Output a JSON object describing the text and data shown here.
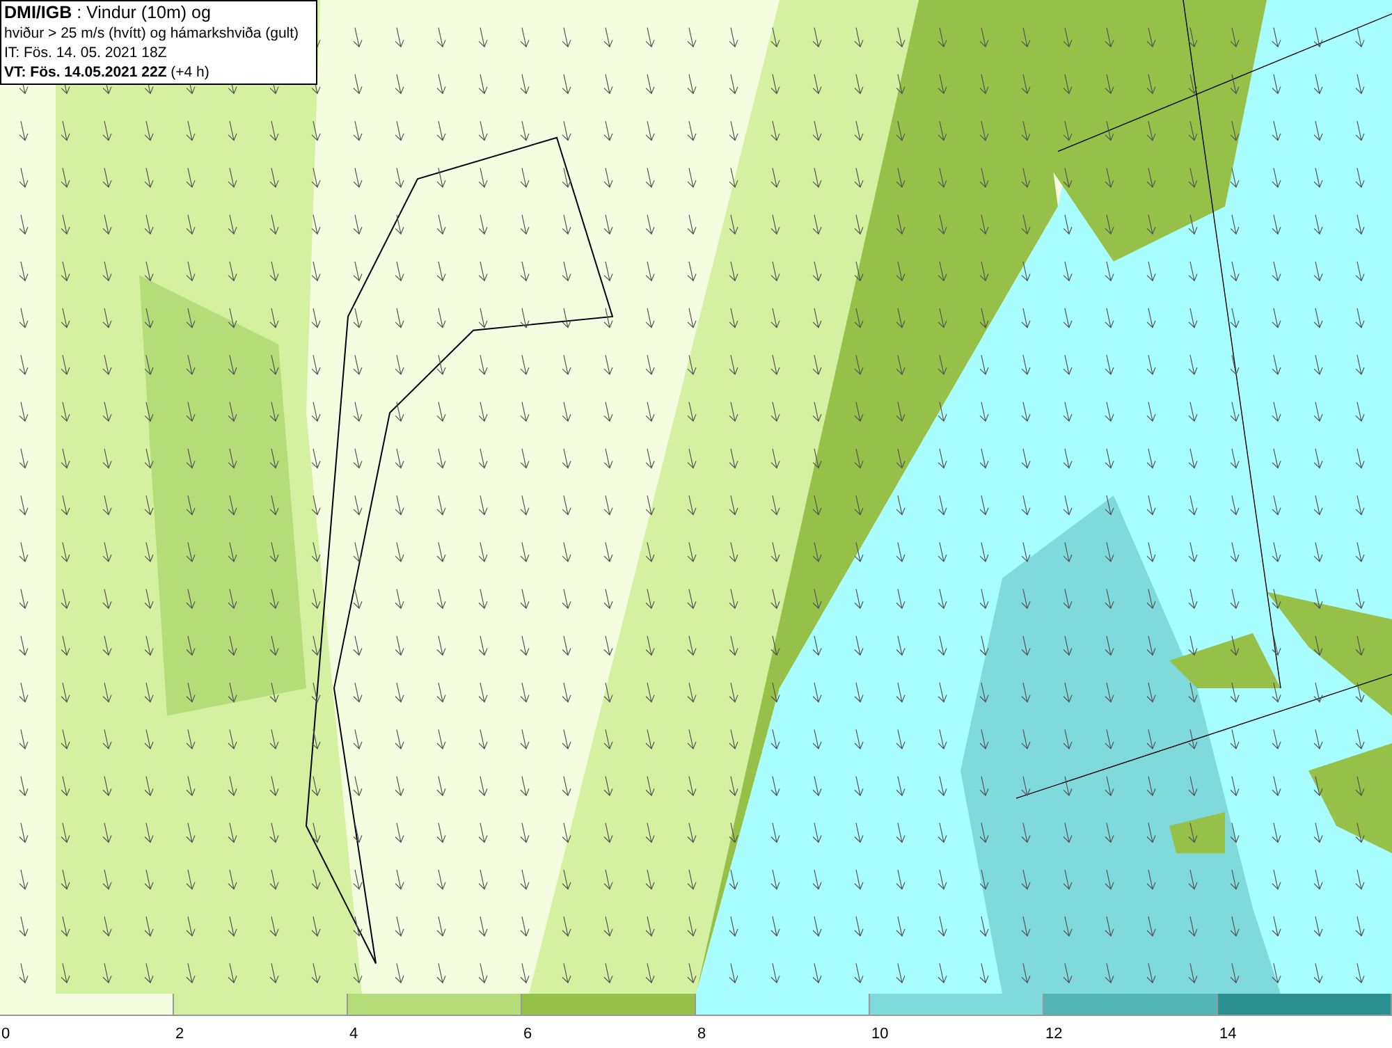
{
  "info_box": {
    "lines": [
      "**DMI/IGB** : Vindur (10m) og",
      "hviður > 25 m/s (hvítt) og hámarkshviða (gult)",
      "IT: Fös. 14. 05. 2021 18Z",
      "**VT: Fös. 14.05.2021 22Z** (+4 h)"
    ]
  },
  "legend": {
    "swatches": [
      {
        "color": "#f5fde0",
        "label": "0"
      },
      {
        "color": "#d4f0a0",
        "label": "2"
      },
      {
        "color": "#b5dc78",
        "label": "4"
      },
      {
        "color": "#96c048",
        "label": "6"
      },
      {
        "color": "#a8fdfe",
        "label": "8"
      },
      {
        "color": "#80dadb",
        "label": "10"
      },
      {
        "color": "#52b4b4",
        "label": "12"
      },
      {
        "color": "#2a9090",
        "label": "14"
      }
    ]
  }
}
